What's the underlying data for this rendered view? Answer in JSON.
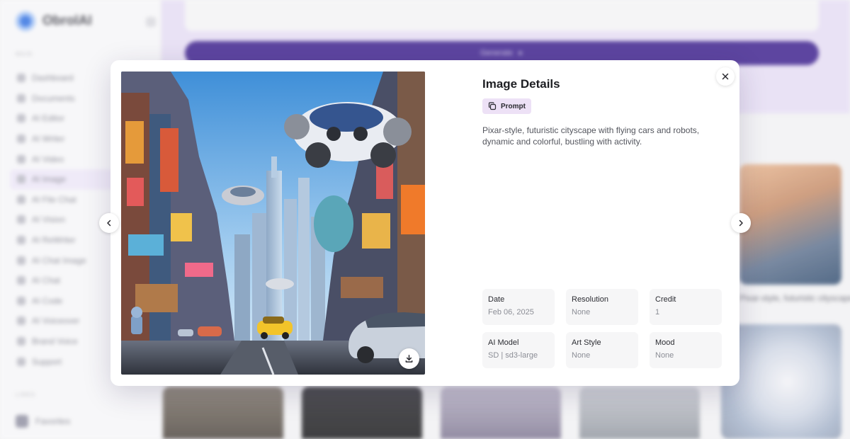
{
  "app": {
    "name": "ObrolAI",
    "menu_label": "MAIN",
    "nav_items": [
      "Dashboard",
      "Documents",
      "AI Editor",
      "AI Writer",
      "AI Video",
      "AI Image",
      "AI File Chat",
      "AI Vision",
      "AI ReWriter",
      "AI Chat Image",
      "AI Chat",
      "AI Code",
      "AI Voiceover",
      "Brand Voice",
      "Support"
    ],
    "active_nav": "AI Image",
    "links_label": "LINKS",
    "links": [
      "Favorites"
    ],
    "generate_label": "Generate",
    "gallery_caption": "Pixar-style, futuristic cityscape..."
  },
  "modal": {
    "title": "Image Details",
    "prompt_label": "Prompt",
    "prompt_text": "Pixar-style, futuristic cityscape with flying cars and robots, dynamic and colorful, bustling with activity.",
    "meta": [
      {
        "label": "Date",
        "value": "Feb 06, 2025"
      },
      {
        "label": "Resolution",
        "value": "None"
      },
      {
        "label": "Credit",
        "value": "1"
      },
      {
        "label": "AI Model",
        "value": "SD | sd3-large"
      },
      {
        "label": "Art Style",
        "value": "None"
      },
      {
        "label": "Mood",
        "value": "None"
      }
    ]
  },
  "icons": {
    "close": "close-icon",
    "prev": "chevron-left-icon",
    "next": "chevron-right-icon",
    "download": "download-icon",
    "copy": "copy-icon"
  },
  "colors": {
    "accent": "#3a1d8c",
    "chip_bg": "#ede1f6",
    "panel_bg": "#e5dcf3"
  }
}
